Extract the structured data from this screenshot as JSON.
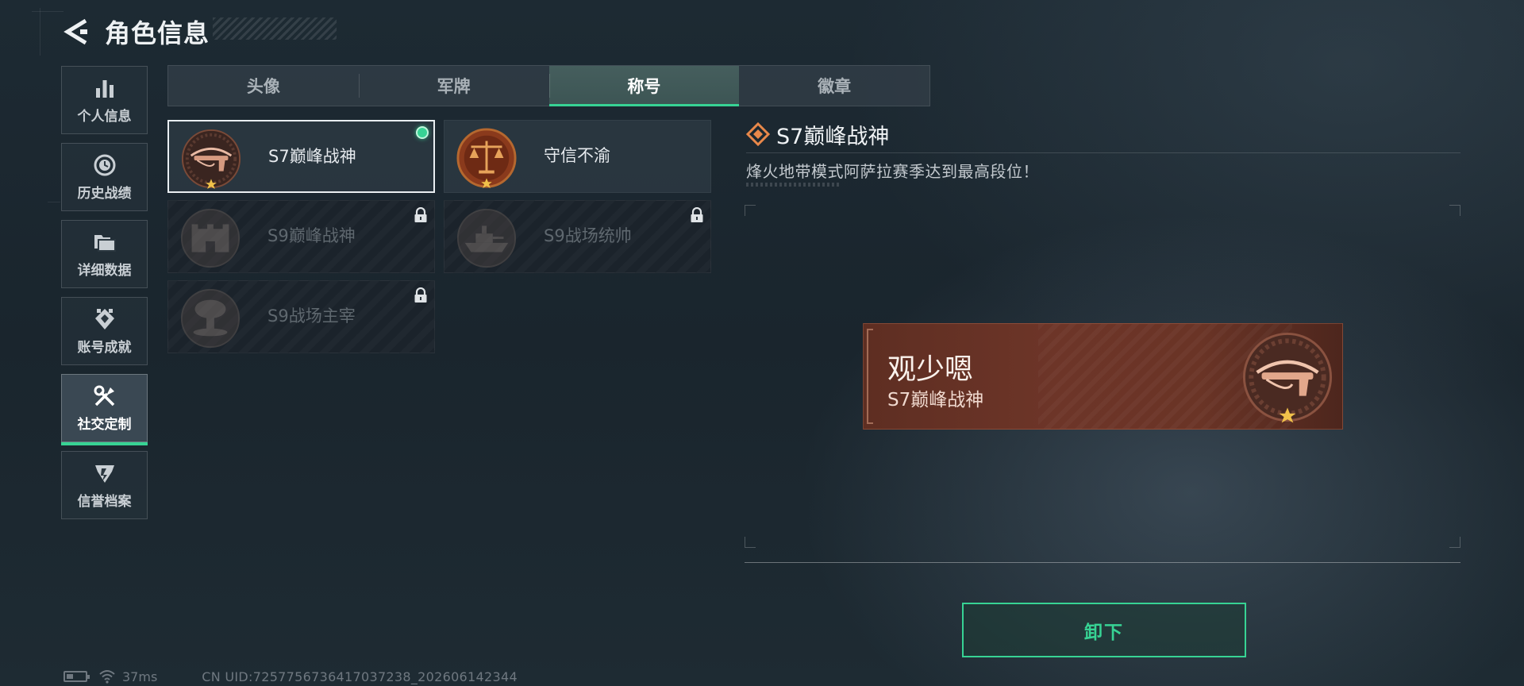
{
  "header": {
    "title": "角色信息",
    "back_icon": "back-arrow-icon"
  },
  "sidebar": {
    "items": [
      {
        "label": "个人信息",
        "icon": "bar-chart-icon",
        "active": false
      },
      {
        "label": "历史战绩",
        "icon": "clock-icon",
        "active": false
      },
      {
        "label": "详细数据",
        "icon": "folder-icon",
        "active": false
      },
      {
        "label": "账号成就",
        "icon": "achievement-icon",
        "active": false
      },
      {
        "label": "社交定制",
        "icon": "tools-icon",
        "active": true
      },
      {
        "label": "信誉档案",
        "icon": "reputation-icon",
        "active": false
      }
    ]
  },
  "tabs": [
    {
      "label": "头像",
      "active": false
    },
    {
      "label": "军牌",
      "active": false
    },
    {
      "label": "称号",
      "active": true
    },
    {
      "label": "徽章",
      "active": false
    }
  ],
  "titles": [
    {
      "label": "S7巅峰战神",
      "emblem": "crossbow-emblem",
      "locked": false,
      "selected": true,
      "equipped": true
    },
    {
      "label": "守信不渝",
      "emblem": "scales-emblem",
      "locked": false,
      "selected": false,
      "equipped": false
    },
    {
      "label": "S9巅峰战神",
      "emblem": "fortress-emblem",
      "locked": true,
      "selected": false,
      "equipped": false
    },
    {
      "label": "S9战场统帅",
      "emblem": "warship-emblem",
      "locked": true,
      "selected": false,
      "equipped": false
    },
    {
      "label": "S9战场主宰",
      "emblem": "mushroom-cloud-emblem",
      "locked": true,
      "selected": false,
      "equipped": false
    }
  ],
  "detail": {
    "title": "S7巅峰战神",
    "description": "烽火地带模式阿萨拉赛季达到最高段位！"
  },
  "nameplate": {
    "player_name": "观少嗯",
    "title": "S7巅峰战神"
  },
  "actions": {
    "unequip_label": "卸下"
  },
  "status": {
    "ping": "37ms",
    "uid": "CN UID:7257756736417037238_202606142344"
  },
  "colors": {
    "accent": "#37d394",
    "nameplate": "#6d3528",
    "background": "#1d2a33"
  }
}
